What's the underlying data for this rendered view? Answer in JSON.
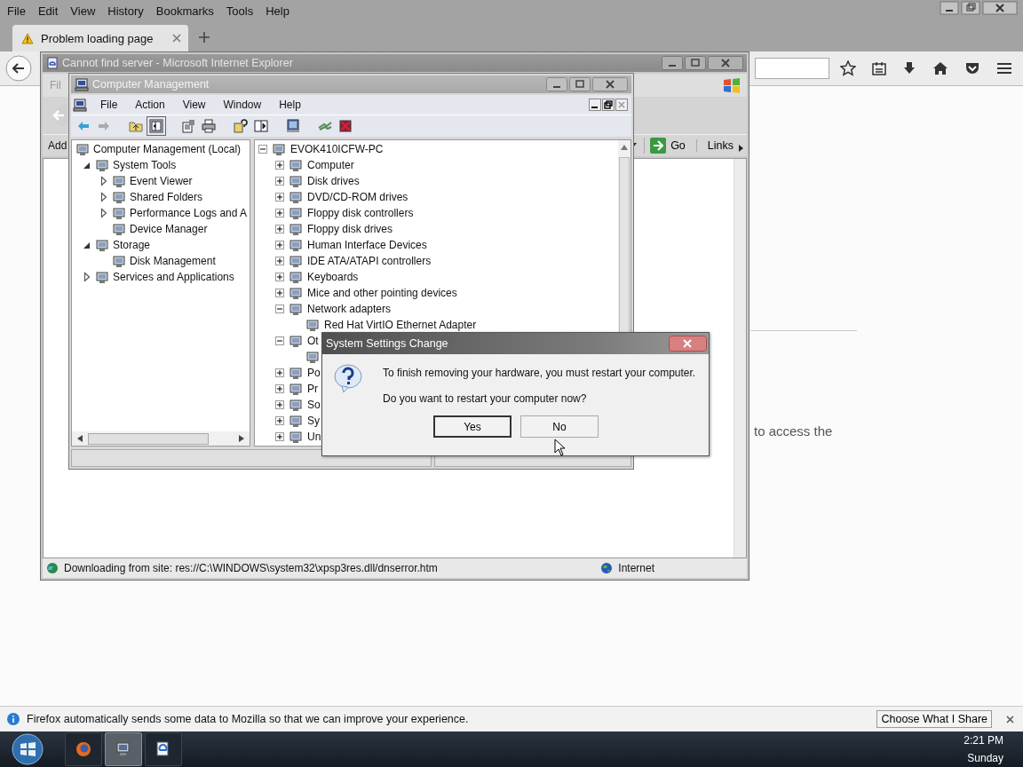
{
  "firefox": {
    "menu": [
      "File",
      "Edit",
      "View",
      "History",
      "Bookmarks",
      "Tools",
      "Help"
    ],
    "tabs": [
      {
        "title": "Problem loading page",
        "selected": true
      }
    ],
    "page_text": "to access the",
    "notification": {
      "text": "Firefox automatically sends some data to Mozilla so that we can improve your experience.",
      "button": "Choose What I Share"
    }
  },
  "ie_window": {
    "title": "Cannot find server - Microsoft Internet Explorer",
    "menu": [
      "Fil"
    ],
    "address_label": "Add",
    "go": "Go",
    "links": "Links",
    "status": "Downloading from site: res://C:\\WINDOWS\\system32\\xpsp3res.dll/dnserror.htm",
    "zone": "Internet"
  },
  "cm_window": {
    "title": "Computer Management",
    "menu": [
      "File",
      "Action",
      "View",
      "Window",
      "Help"
    ],
    "left_tree": [
      {
        "label": "Computer Management (Local)",
        "expandable": false,
        "children": [
          {
            "label": "System Tools",
            "expandable": true,
            "expanded": true,
            "children": [
              {
                "label": "Event Viewer",
                "expandable": true,
                "expanded": false
              },
              {
                "label": "Shared Folders",
                "expandable": true,
                "expanded": false
              },
              {
                "label": "Performance Logs and A",
                "expandable": true,
                "expanded": false
              },
              {
                "label": "Device Manager",
                "expandable": false
              }
            ]
          },
          {
            "label": "Storage",
            "expandable": true,
            "expanded": true,
            "children": [
              {
                "label": "Disk Management",
                "expandable": false
              }
            ]
          },
          {
            "label": "Services and Applications",
            "expandable": true,
            "expanded": false
          }
        ]
      }
    ],
    "right_tree": [
      {
        "label": "EVOK410ICFW-PC",
        "expandable": true,
        "expanded": true,
        "children": [
          {
            "label": "Computer",
            "expandable": true,
            "expanded": false
          },
          {
            "label": "Disk drives",
            "expandable": true,
            "expanded": false
          },
          {
            "label": "DVD/CD-ROM drives",
            "expandable": true,
            "expanded": false
          },
          {
            "label": "Floppy disk controllers",
            "expandable": true,
            "expanded": false
          },
          {
            "label": "Floppy disk drives",
            "expandable": true,
            "expanded": false
          },
          {
            "label": "Human Interface Devices",
            "expandable": true,
            "expanded": false
          },
          {
            "label": "IDE ATA/ATAPI controllers",
            "expandable": true,
            "expanded": false
          },
          {
            "label": "Keyboards",
            "expandable": true,
            "expanded": false
          },
          {
            "label": "Mice and other pointing devices",
            "expandable": true,
            "expanded": false
          },
          {
            "label": "Network adapters",
            "expandable": true,
            "expanded": true,
            "children": [
              {
                "label": "Red Hat VirtIO Ethernet Adapter",
                "expandable": false
              }
            ]
          },
          {
            "label": "Ot",
            "expandable": true,
            "expanded": true,
            "children": [
              {
                "expandable": false
              }
            ]
          },
          {
            "label": "Po",
            "expandable": true,
            "expanded": false
          },
          {
            "label": "Pr",
            "expandable": true,
            "expanded": false
          },
          {
            "label": "So",
            "expandable": true,
            "expanded": false
          },
          {
            "label": "Sy",
            "expandable": true,
            "expanded": false
          },
          {
            "label": "Un",
            "expandable": true,
            "expanded": false
          }
        ]
      }
    ]
  },
  "dialog": {
    "title": "System Settings Change",
    "message": "To finish removing your hardware, you must restart your computer.",
    "question": "Do you want to restart your computer now?",
    "buttons": [
      {
        "label": "Yes",
        "default": true
      },
      {
        "label": "No",
        "default": false
      }
    ]
  },
  "taskbar": {
    "items": [
      {
        "kind": "firefox",
        "selected": false
      },
      {
        "kind": "computer-management",
        "selected": true
      },
      {
        "kind": "internet-explorer",
        "selected": false
      }
    ],
    "time": "2:21 PM",
    "day": "Sunday"
  }
}
